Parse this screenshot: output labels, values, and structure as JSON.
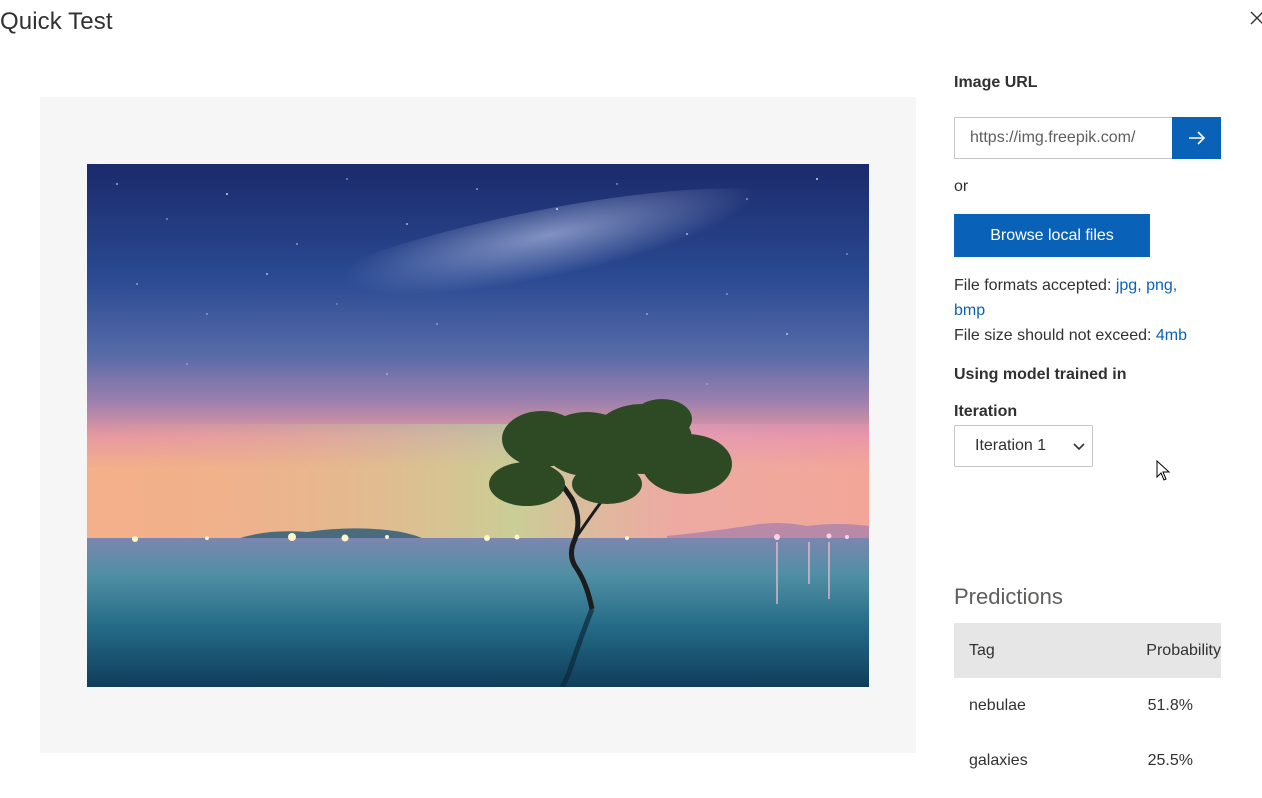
{
  "dialog": {
    "title": "Quick Test",
    "close_icon": "close-icon"
  },
  "image_url": {
    "label": "Image URL",
    "value": "https://img.freepik.com/",
    "go_icon": "arrow-right-icon"
  },
  "or_text": "or",
  "browse": {
    "label": "Browse local files"
  },
  "file_info": {
    "formats_prefix": "File formats accepted: ",
    "formats_line1": "jpg, png,",
    "formats_line2": "bmp",
    "size_prefix": "File size should not exceed: ",
    "size_value": "4mb"
  },
  "model": {
    "heading": "Using model trained in",
    "iteration_label": "Iteration",
    "iteration_selected": "Iteration 1"
  },
  "predictions": {
    "title": "Predictions",
    "columns": [
      "Tag",
      "Probability"
    ],
    "rows": [
      {
        "tag": "nebulae",
        "probability": "51.8%"
      },
      {
        "tag": "galaxies",
        "probability": "25.5%"
      }
    ]
  },
  "colors": {
    "accent": "#0a62b8",
    "preview_bg": "#f6f6f6",
    "table_header_bg": "#e6e6e6"
  }
}
